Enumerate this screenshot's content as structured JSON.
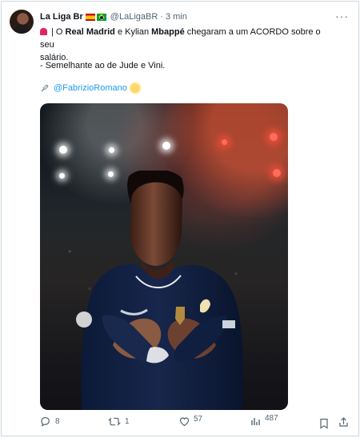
{
  "tweet": {
    "author_name": "La Liga Br",
    "handle": "@LaLigaBR",
    "separator": "·",
    "time": "3 min",
    "more_label": "···",
    "text_prefix": "| O ",
    "text_bold_1": "Real Madrid",
    "text_mid_1": " e Kylian ",
    "text_bold_2": "Mbappé",
    "text_mid_2": " chegaram a um ACORDO sobre o seu",
    "text_wrap": "salário.",
    "line2": "- Semelhante ao de Jude e Vini.",
    "mention": "@FabrizioRomano"
  },
  "actions": {
    "replies": "8",
    "retweets": "1",
    "likes": "57",
    "views": "487"
  },
  "colors": {
    "link": "#1d9bf0",
    "muted": "#536471",
    "jersey": "#17264b"
  }
}
